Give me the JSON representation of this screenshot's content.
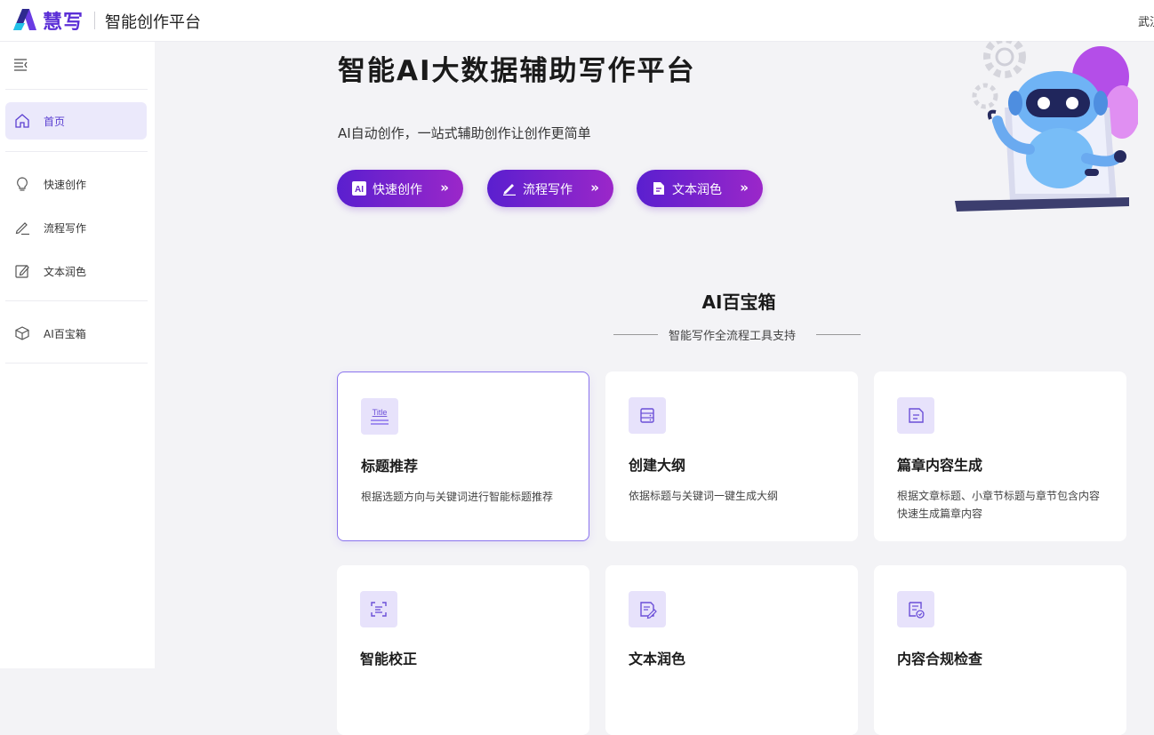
{
  "header": {
    "brand": "慧写",
    "platform": "智能创作平台",
    "user": "武汉"
  },
  "sidebar": {
    "items": [
      {
        "label": "首页",
        "icon": "home-icon",
        "active": true
      },
      {
        "label": "快速创作",
        "icon": "lightbulb-icon"
      },
      {
        "label": "流程写作",
        "icon": "pen-icon"
      },
      {
        "label": "文本润色",
        "icon": "edit-icon"
      },
      {
        "label": "AI百宝箱",
        "icon": "box-icon"
      }
    ]
  },
  "hero": {
    "title": "智能AI大数据辅助写作平台",
    "subtitle": "AI自动创作，一站式辅助创作让创作更简单",
    "buttons": [
      {
        "label": "快速创作",
        "icon": "ai-icon",
        "arrow": "»"
      },
      {
        "label": "流程写作",
        "icon": "pen-icon",
        "arrow": "»"
      },
      {
        "label": "文本润色",
        "icon": "document-icon",
        "arrow": "»"
      }
    ]
  },
  "toolbox": {
    "title": "AI百宝箱",
    "subtitle": "智能写作全流程工具支持",
    "cards": [
      {
        "title": "标题推荐",
        "desc": "根据选题方向与关键词进行智能标题推荐",
        "icon": "title-icon",
        "icon_text": "Title"
      },
      {
        "title": "创建大纲",
        "desc": "依据标题与关键词一键生成大纲",
        "icon": "outline-icon"
      },
      {
        "title": "篇章内容生成",
        "desc": "根据文章标题、小章节标题与章节包含内容快速生成篇章内容",
        "icon": "document-icon"
      },
      {
        "title": "智能校正",
        "desc": "",
        "icon": "scan-icon"
      },
      {
        "title": "文本润色",
        "desc": "",
        "icon": "edit-document-icon"
      },
      {
        "title": "内容合规检查",
        "desc": "",
        "icon": "check-document-icon"
      }
    ]
  },
  "colors": {
    "accent": "#5b2fd6",
    "button_gradient_start": "#5a1fcf",
    "button_gradient_end": "#9b27c9",
    "active_nav_bg": "#ebe9fb",
    "card_icon_bg": "#e7e2fb"
  }
}
